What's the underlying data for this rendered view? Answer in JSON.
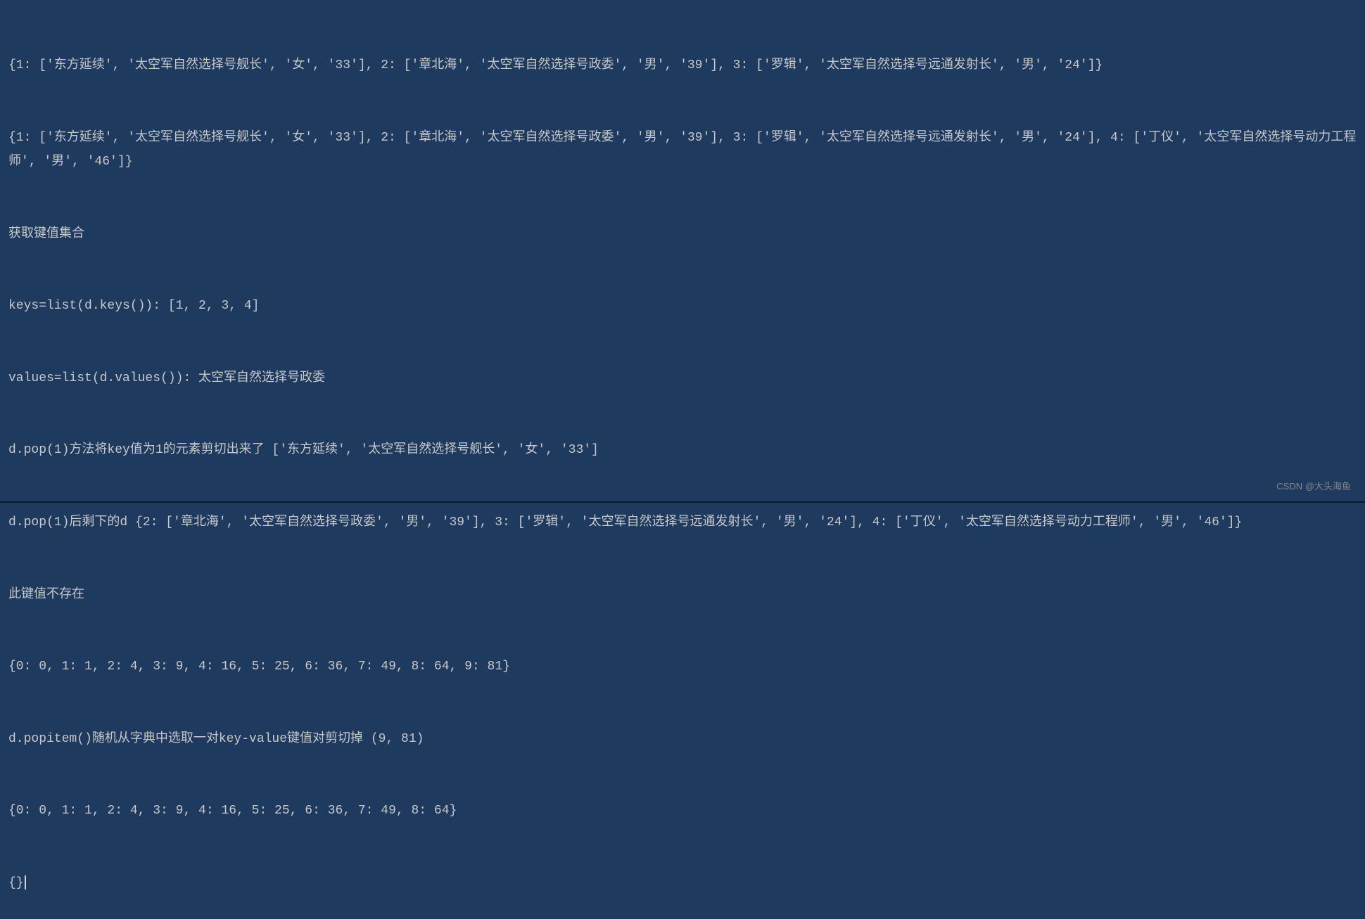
{
  "terminal": {
    "lines": [
      "{1: ['东方延续', '太空军自然选择号舰长', '女', '33'], 2: ['章北海', '太空军自然选择号政委', '男', '39'], 3: ['罗辑', '太空军自然选择号远通发射长', '男', '24']}",
      "{1: ['东方延续', '太空军自然选择号舰长', '女', '33'], 2: ['章北海', '太空军自然选择号政委', '男', '39'], 3: ['罗辑', '太空军自然选择号远通发射长', '男', '24'], 4: ['丁仪', '太空军自然选择号动力工程师', '男', '46']}",
      "获取键值集合",
      "keys=list(d.keys()): [1, 2, 3, 4]",
      "values=list(d.values()): 太空军自然选择号政委",
      "d.pop(1)方法将key值为1的元素剪切出来了 ['东方延续', '太空军自然选择号舰长', '女', '33']",
      "d.pop(1)后剩下的d {2: ['章北海', '太空军自然选择号政委', '男', '39'], 3: ['罗辑', '太空军自然选择号远通发射长', '男', '24'], 4: ['丁仪', '太空军自然选择号动力工程师', '男', '46']}",
      "此键值不存在",
      "{0: 0, 1: 1, 2: 4, 3: 9, 4: 16, 5: 25, 6: 36, 7: 49, 8: 64, 9: 81}",
      "d.popitem()随机从字典中选取一对key-value键值对剪切掉 (9, 81)",
      "{0: 0, 1: 1, 2: 4, 3: 9, 4: 16, 5: 25, 6: 36, 7: 49, 8: 64}",
      "{}"
    ]
  },
  "watermark": "CSDN @大头海鱼"
}
